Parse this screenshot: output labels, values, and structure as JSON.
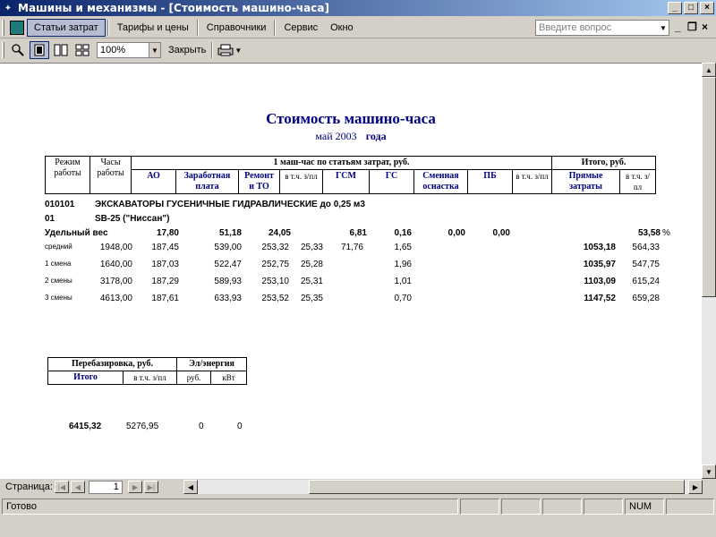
{
  "window": {
    "title": "Машины и механизмы - [Стоимость машино-часа]",
    "controls": [
      "_",
      "□",
      "×"
    ]
  },
  "menu": {
    "items": [
      "Статьи затрат",
      "Тарифы и цены",
      "Справочники",
      "Сервис",
      "Окно"
    ],
    "help_placeholder": "Введите вопрос"
  },
  "toolbar": {
    "zoom": "100%",
    "close_label": "Закрыть"
  },
  "report": {
    "title": "Стоимость машино-часа",
    "period": "май 2003",
    "period_unit": "года",
    "headers": {
      "mode": "Режим работы",
      "hours": "Часы работы",
      "group": "1 маш-час по статьям затрат, руб.",
      "total_group": "Итого, руб.",
      "ao": "АО",
      "salary": "Заработная плата",
      "repair": "Ремонт и ТО",
      "incl1": "в т.ч. з/пл",
      "gsm": "ГСМ",
      "gs": "ГС",
      "equip": "Сменная оснастка",
      "pb": "ПБ",
      "incl2": "в т.ч. з/пл",
      "direct": "Прямые затраты",
      "incl3": "в т.ч. з/пл"
    },
    "group_code": "010101",
    "group_name": "ЭКСКАВАТОРЫ ГУСЕНИЧНЫЕ ГИДРАВЛИЧЕСКИЕ до 0,25 м3",
    "item_code": "01",
    "item_name": "SB-25 (\"Ниссан\")",
    "specific": {
      "label": "Удельный вес",
      "ao": "17,80",
      "salary": "51,18",
      "repair": "24,05",
      "gsm": "6,81",
      "gs": "0,16",
      "equip": "0,00",
      "pb": "0,00",
      "incl3": "53,58",
      "pct": "%"
    },
    "rows": [
      {
        "mode": "средний",
        "hours": "1948,00",
        "ao": "187,45",
        "salary": "539,00",
        "repair": "253,32",
        "incl1": "25,33",
        "gsm": "71,76",
        "gs": "1,65",
        "direct": "1053,18",
        "incl3": "564,33"
      },
      {
        "mode": "1 смена",
        "hours": "1640,00",
        "ao": "187,03",
        "salary": "522,47",
        "repair": "252,75",
        "incl1": "25,28",
        "gsm": "",
        "gs": "1,96",
        "direct": "1035,97",
        "incl3": "547,75"
      },
      {
        "mode": "2 смены",
        "hours": "3178,00",
        "ao": "187,29",
        "salary": "589,93",
        "repair": "253,10",
        "incl1": "25,31",
        "gsm": "",
        "gs": "1,01",
        "direct": "1103,09",
        "incl3": "615,24"
      },
      {
        "mode": "3 смены",
        "hours": "4613,00",
        "ao": "187,61",
        "salary": "633,93",
        "repair": "253,52",
        "incl1": "25,35",
        "gsm": "",
        "gs": "0,70",
        "direct": "1147,52",
        "incl3": "659,28"
      }
    ],
    "rebase": {
      "header": "Перебазировка, руб.",
      "energy": "Эл/энергия",
      "total": "Итого",
      "incl": "в т.ч. з/пл",
      "rub": "руб.",
      "kwt": "кВт",
      "values": {
        "total": "6415,32",
        "incl": "5276,95",
        "rub": "0",
        "kwt": "0"
      }
    }
  },
  "pager": {
    "label": "Страница:",
    "page": "1"
  },
  "status": {
    "text": "Готово",
    "num": "NUM"
  }
}
